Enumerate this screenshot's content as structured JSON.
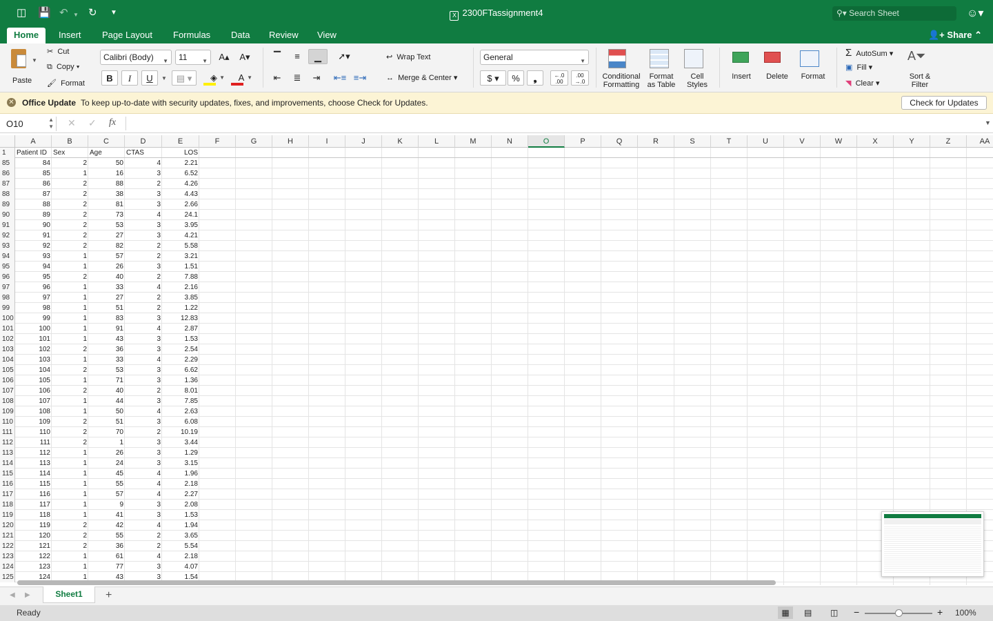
{
  "titlebar": {
    "title": "2300FTassignment4",
    "search_placeholder": "Search Sheet",
    "share": "Share"
  },
  "ribbon_tabs": [
    "Home",
    "Insert",
    "Page Layout",
    "Formulas",
    "Data",
    "Review",
    "View"
  ],
  "clipboard": {
    "paste": "Paste",
    "cut": "Cut",
    "copy": "Copy",
    "format": "Format"
  },
  "font": {
    "name": "Calibri (Body)",
    "size": "11",
    "bold": "B",
    "italic": "I",
    "underline": "U"
  },
  "alignment": {
    "wrap_text": "Wrap Text",
    "merge_center": "Merge & Center"
  },
  "number": {
    "format": "General",
    "currency": "$",
    "percent": "%",
    "comma": "❟",
    "inc_decimal": "←.0\n.00",
    "dec_decimal": ".00\n→.0"
  },
  "styles": {
    "conditional": "Conditional\nFormatting",
    "format_table": "Format\nas Table",
    "cell_styles": "Cell\nStyles"
  },
  "cells": {
    "insert": "Insert",
    "delete": "Delete",
    "format": "Format"
  },
  "editing": {
    "autosum": "AutoSum",
    "fill": "Fill",
    "clear": "Clear",
    "sort_filter": "Sort &\nFilter"
  },
  "notice": {
    "title": "Office Update",
    "text": "To keep up-to-date with security updates, fixes, and improvements, choose Check for Updates.",
    "button": "Check for Updates"
  },
  "formula_bar": {
    "name_box": "O10",
    "fx": "fx",
    "formula": ""
  },
  "columns": [
    "A",
    "B",
    "C",
    "D",
    "E",
    "F",
    "G",
    "H",
    "I",
    "J",
    "K",
    "L",
    "M",
    "N",
    "O",
    "P",
    "Q",
    "R",
    "S",
    "T",
    "U",
    "V",
    "W",
    "X",
    "Y",
    "Z",
    "AA"
  ],
  "selected_column": "O",
  "header_row": {
    "number": "1",
    "values": [
      "Patient ID",
      "Sex",
      "Age",
      "CTAS",
      "LOS"
    ]
  },
  "rows": [
    {
      "n": "85",
      "v": [
        "84",
        "2",
        "50",
        "4",
        "2.21"
      ]
    },
    {
      "n": "86",
      "v": [
        "85",
        "1",
        "16",
        "3",
        "6.52"
      ]
    },
    {
      "n": "87",
      "v": [
        "86",
        "2",
        "88",
        "2",
        "4.26"
      ]
    },
    {
      "n": "88",
      "v": [
        "87",
        "2",
        "38",
        "3",
        "4.43"
      ]
    },
    {
      "n": "89",
      "v": [
        "88",
        "2",
        "81",
        "3",
        "2.66"
      ]
    },
    {
      "n": "90",
      "v": [
        "89",
        "2",
        "73",
        "4",
        "24.1"
      ]
    },
    {
      "n": "91",
      "v": [
        "90",
        "2",
        "53",
        "3",
        "3.95"
      ]
    },
    {
      "n": "92",
      "v": [
        "91",
        "2",
        "27",
        "3",
        "4.21"
      ]
    },
    {
      "n": "93",
      "v": [
        "92",
        "2",
        "82",
        "2",
        "5.58"
      ]
    },
    {
      "n": "94",
      "v": [
        "93",
        "1",
        "57",
        "2",
        "3.21"
      ]
    },
    {
      "n": "95",
      "v": [
        "94",
        "1",
        "26",
        "3",
        "1.51"
      ]
    },
    {
      "n": "96",
      "v": [
        "95",
        "2",
        "40",
        "2",
        "7.88"
      ]
    },
    {
      "n": "97",
      "v": [
        "96",
        "1",
        "33",
        "4",
        "2.16"
      ]
    },
    {
      "n": "98",
      "v": [
        "97",
        "1",
        "27",
        "2",
        "3.85"
      ]
    },
    {
      "n": "99",
      "v": [
        "98",
        "1",
        "51",
        "2",
        "1.22"
      ]
    },
    {
      "n": "100",
      "v": [
        "99",
        "1",
        "83",
        "3",
        "12.83"
      ]
    },
    {
      "n": "101",
      "v": [
        "100",
        "1",
        "91",
        "4",
        "2.87"
      ]
    },
    {
      "n": "102",
      "v": [
        "101",
        "1",
        "43",
        "3",
        "1.53"
      ]
    },
    {
      "n": "103",
      "v": [
        "102",
        "2",
        "36",
        "3",
        "2.54"
      ]
    },
    {
      "n": "104",
      "v": [
        "103",
        "1",
        "33",
        "4",
        "2.29"
      ]
    },
    {
      "n": "105",
      "v": [
        "104",
        "2",
        "53",
        "3",
        "6.62"
      ]
    },
    {
      "n": "106",
      "v": [
        "105",
        "1",
        "71",
        "3",
        "1.36"
      ]
    },
    {
      "n": "107",
      "v": [
        "106",
        "2",
        "40",
        "2",
        "8.01"
      ]
    },
    {
      "n": "108",
      "v": [
        "107",
        "1",
        "44",
        "3",
        "7.85"
      ]
    },
    {
      "n": "109",
      "v": [
        "108",
        "1",
        "50",
        "4",
        "2.63"
      ]
    },
    {
      "n": "110",
      "v": [
        "109",
        "2",
        "51",
        "3",
        "6.08"
      ]
    },
    {
      "n": "111",
      "v": [
        "110",
        "2",
        "70",
        "2",
        "10.19"
      ]
    },
    {
      "n": "112",
      "v": [
        "111",
        "2",
        "1",
        "3",
        "3.44"
      ]
    },
    {
      "n": "113",
      "v": [
        "112",
        "1",
        "26",
        "3",
        "1.29"
      ]
    },
    {
      "n": "114",
      "v": [
        "113",
        "1",
        "24",
        "3",
        "3.15"
      ]
    },
    {
      "n": "115",
      "v": [
        "114",
        "1",
        "45",
        "4",
        "1.96"
      ]
    },
    {
      "n": "116",
      "v": [
        "115",
        "1",
        "55",
        "4",
        "2.18"
      ]
    },
    {
      "n": "117",
      "v": [
        "116",
        "1",
        "57",
        "4",
        "2.27"
      ]
    },
    {
      "n": "118",
      "v": [
        "117",
        "1",
        "9",
        "3",
        "2.08"
      ]
    },
    {
      "n": "119",
      "v": [
        "118",
        "1",
        "41",
        "3",
        "1.53"
      ]
    },
    {
      "n": "120",
      "v": [
        "119",
        "2",
        "42",
        "4",
        "1.94"
      ]
    },
    {
      "n": "121",
      "v": [
        "120",
        "2",
        "55",
        "2",
        "3.65"
      ]
    },
    {
      "n": "122",
      "v": [
        "121",
        "2",
        "36",
        "2",
        "5.54"
      ]
    },
    {
      "n": "123",
      "v": [
        "122",
        "1",
        "61",
        "4",
        "2.18"
      ]
    },
    {
      "n": "124",
      "v": [
        "123",
        "1",
        "77",
        "3",
        "4.07"
      ]
    },
    {
      "n": "125",
      "v": [
        "124",
        "1",
        "43",
        "3",
        "1.54"
      ]
    }
  ],
  "sheets": [
    "Sheet1"
  ],
  "add_sheet": "+",
  "status": {
    "text": "Ready",
    "zoom": "100%",
    "zoom_minus": "−",
    "zoom_plus": "+"
  },
  "colors": {
    "brand": "#107c41",
    "notice_bg": "#fcf4d5"
  }
}
